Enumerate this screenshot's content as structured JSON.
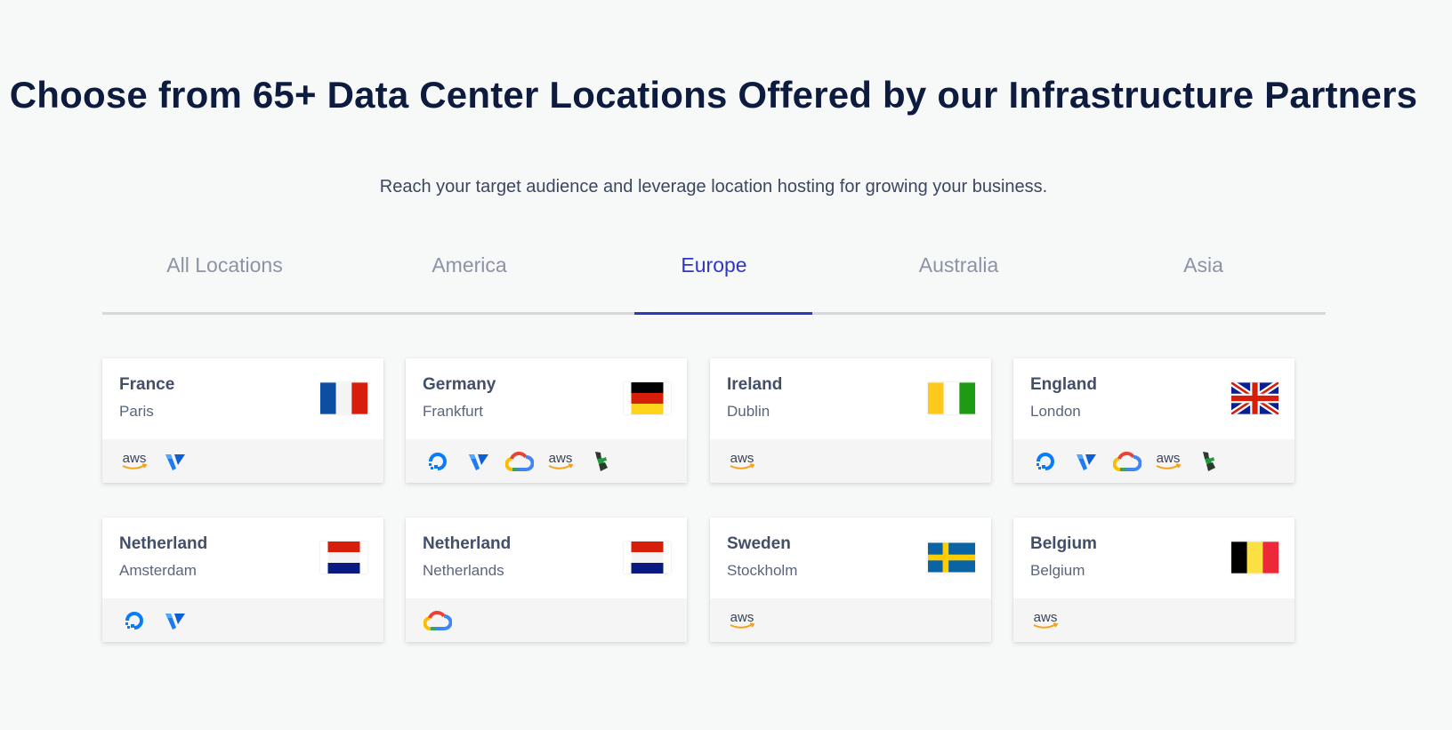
{
  "header": {
    "title": "Choose from 65+ Data Center Locations Offered by our Infrastructure Partners",
    "subtitle": "Reach your target audience and leverage location hosting for growing your business."
  },
  "tabs": [
    {
      "label": "All Locations",
      "active": false
    },
    {
      "label": "America",
      "active": false
    },
    {
      "label": "Europe",
      "active": true
    },
    {
      "label": "Australia",
      "active": false
    },
    {
      "label": "Asia",
      "active": false
    }
  ],
  "colors": {
    "accent": "#2f37c2",
    "title": "#0d1b3e",
    "tab_inactive": "#8c93a6"
  },
  "locations": [
    {
      "country": "France",
      "city": "Paris",
      "flag": "flag-france",
      "providers": [
        "aws",
        "vultr"
      ]
    },
    {
      "country": "Germany",
      "city": "Frankfurt",
      "flag": "flag-germany",
      "providers": [
        "digitalocean",
        "vultr",
        "google-cloud",
        "aws",
        "linode"
      ]
    },
    {
      "country": "Ireland",
      "city": "Dublin",
      "flag": "flag-ireland",
      "providers": [
        "aws"
      ]
    },
    {
      "country": "England",
      "city": "London",
      "flag": "flag-uk",
      "providers": [
        "digitalocean",
        "vultr",
        "google-cloud",
        "aws",
        "linode"
      ]
    },
    {
      "country": "Netherland",
      "city": "Amsterdam",
      "flag": "flag-netherlands",
      "providers": [
        "digitalocean",
        "vultr"
      ]
    },
    {
      "country": "Netherland",
      "city": "Netherlands",
      "flag": "flag-netherlands",
      "providers": [
        "google-cloud"
      ]
    },
    {
      "country": "Sweden",
      "city": "Stockholm",
      "flag": "flag-sweden",
      "providers": [
        "aws"
      ]
    },
    {
      "country": "Belgium",
      "city": "Belgium",
      "flag": "flag-belgium",
      "providers": [
        "aws"
      ]
    }
  ]
}
